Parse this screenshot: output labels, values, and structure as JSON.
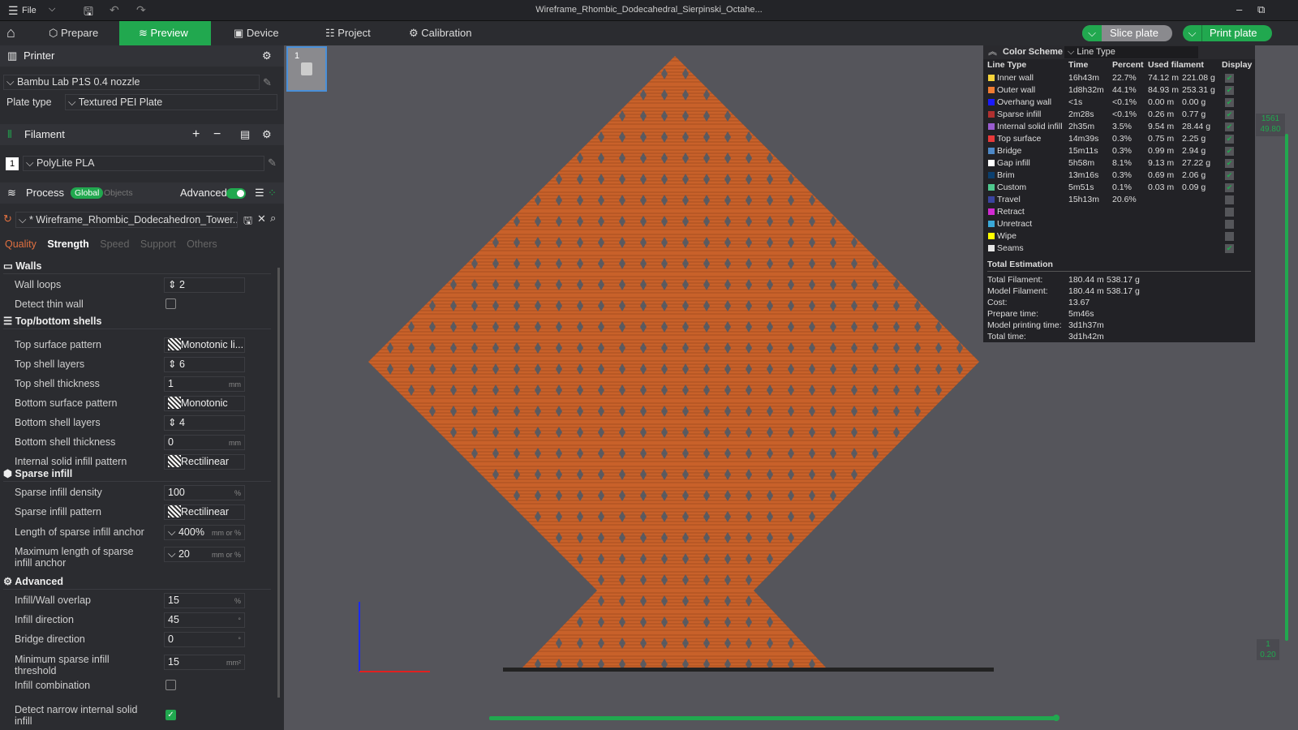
{
  "window": {
    "title": "Wireframe_Rhombic_Dodecahedral_Sierpinski_Octahe...",
    "file_menu": "File"
  },
  "tabs": [
    {
      "label": "Prepare"
    },
    {
      "label": "Preview"
    },
    {
      "label": "Device"
    },
    {
      "label": "Project"
    },
    {
      "label": "Calibration"
    }
  ],
  "actions": {
    "slice": "Slice plate",
    "print": "Print plate"
  },
  "printer": {
    "header": "Printer",
    "name": "Bambu Lab P1S 0.4 nozzle",
    "plate_label": "Plate type",
    "plate_value": "Textured PEI Plate"
  },
  "filament": {
    "header": "Filament",
    "index": "1",
    "name": "PolyLite PLA"
  },
  "process": {
    "header": "Process",
    "global": "Global",
    "objects": "Objects",
    "advanced": "Advanced",
    "advanced_on": true,
    "preset": "* Wireframe_Rhombic_Dodecahedron_Tower..."
  },
  "subtabs": [
    "Quality",
    "Strength",
    "Speed",
    "Support",
    "Others"
  ],
  "groups": {
    "walls": "Walls",
    "shells": "Top/bottom shells",
    "sparse": "Sparse infill",
    "advanced": "Advanced"
  },
  "settings": [
    {
      "label": "Wall loops",
      "value": "2",
      "type": "spin"
    },
    {
      "label": "Detect thin wall",
      "type": "check",
      "checked": false
    },
    {
      "label": "Top surface pattern",
      "value": "Monotonic li...",
      "type": "pattern"
    },
    {
      "label": "Top shell layers",
      "value": "6",
      "type": "spin"
    },
    {
      "label": "Top shell thickness",
      "value": "1",
      "unit": "mm"
    },
    {
      "label": "Bottom surface pattern",
      "value": "Monotonic",
      "type": "pattern"
    },
    {
      "label": "Bottom shell layers",
      "value": "4",
      "type": "spin"
    },
    {
      "label": "Bottom shell thickness",
      "value": "0",
      "unit": "mm"
    },
    {
      "label": "Internal solid infill pattern",
      "value": "Rectilinear",
      "type": "pattern"
    },
    {
      "label": "Sparse infill density",
      "value": "100",
      "unit": "%"
    },
    {
      "label": "Sparse infill pattern",
      "value": "Rectilinear",
      "type": "pattern"
    },
    {
      "label": "Length of sparse infill anchor",
      "value": "400%",
      "unit": "mm or %",
      "type": "combo"
    },
    {
      "label": "Maximum length of sparse infill anchor",
      "value": "20",
      "unit": "mm or %",
      "type": "combo"
    },
    {
      "label": "Infill/Wall overlap",
      "value": "15",
      "unit": "%"
    },
    {
      "label": "Infill direction",
      "value": "45",
      "unit": "°"
    },
    {
      "label": "Bridge direction",
      "value": "0",
      "unit": "°"
    },
    {
      "label": "Minimum sparse infill threshold",
      "value": "15",
      "unit": "mm²"
    },
    {
      "label": "Infill combination",
      "type": "check",
      "checked": false
    },
    {
      "label": "Detect narrow internal solid infill",
      "type": "check",
      "checked": true
    }
  ],
  "color_scheme": {
    "title": "Color Scheme",
    "mode": "Line Type",
    "headers": [
      "Line Type",
      "Time",
      "Percent",
      "Used filament",
      "Display"
    ],
    "rows": [
      {
        "name": "Inner wall",
        "color": "#f5d33b",
        "time": "16h43m",
        "pct": "22.7%",
        "len": "74.12 m",
        "wt": "221.08 g",
        "on": true
      },
      {
        "name": "Outer wall",
        "color": "#f07c32",
        "time": "1d8h32m",
        "pct": "44.1%",
        "len": "84.93 m",
        "wt": "253.31 g",
        "on": true
      },
      {
        "name": "Overhang wall",
        "color": "#1a1aff",
        "time": "<1s",
        "pct": "<0.1%",
        "len": "0.00 m",
        "wt": "0.00 g",
        "on": true
      },
      {
        "name": "Sparse infill",
        "color": "#b03030",
        "time": "2m28s",
        "pct": "<0.1%",
        "len": "0.26 m",
        "wt": "0.77 g",
        "on": true
      },
      {
        "name": "Internal solid infill",
        "color": "#9a5ccf",
        "time": "2h35m",
        "pct": "3.5%",
        "len": "9.54 m",
        "wt": "28.44 g",
        "on": true
      },
      {
        "name": "Top surface",
        "color": "#e83a3a",
        "time": "14m39s",
        "pct": "0.3%",
        "len": "0.75 m",
        "wt": "2.25 g",
        "on": true
      },
      {
        "name": "Bridge",
        "color": "#4d88c7",
        "time": "15m11s",
        "pct": "0.3%",
        "len": "0.99 m",
        "wt": "2.94 g",
        "on": true
      },
      {
        "name": "Gap infill",
        "color": "#ffffff",
        "time": "5h58m",
        "pct": "8.1%",
        "len": "9.13 m",
        "wt": "27.22 g",
        "on": true
      },
      {
        "name": "Brim",
        "color": "#0b3f6e",
        "time": "13m16s",
        "pct": "0.3%",
        "len": "0.69 m",
        "wt": "2.06 g",
        "on": true
      },
      {
        "name": "Custom",
        "color": "#4fc88e",
        "time": "5m51s",
        "pct": "0.1%",
        "len": "0.03 m",
        "wt": "0.09 g",
        "on": true
      },
      {
        "name": "Travel",
        "color": "#3a44a0",
        "time": "15h13m",
        "pct": "20.6%",
        "len": "",
        "wt": "",
        "on": false
      },
      {
        "name": "Retract",
        "color": "#d22ad2",
        "time": "",
        "pct": "",
        "len": "",
        "wt": "",
        "on": false
      },
      {
        "name": "Unretract",
        "color": "#3aa8d8",
        "time": "",
        "pct": "",
        "len": "",
        "wt": "",
        "on": false
      },
      {
        "name": "Wipe",
        "color": "#ffff00",
        "time": "",
        "pct": "",
        "len": "",
        "wt": "",
        "on": false
      },
      {
        "name": "Seams",
        "color": "#e6e6e6",
        "time": "",
        "pct": "",
        "len": "",
        "wt": "",
        "on": true
      }
    ],
    "total_title": "Total Estimation",
    "totals": [
      {
        "label": "Total Filament:",
        "a": "180.44 m",
        "b": "538.17 g"
      },
      {
        "label": "Model Filament:",
        "a": "180.44 m",
        "b": "538.17 g"
      },
      {
        "label": "Cost:",
        "a": "13.67",
        "b": ""
      },
      {
        "label": "Prepare time:",
        "a": "5m46s",
        "b": ""
      },
      {
        "label": "Model printing time:",
        "a": "3d1h37m",
        "b": ""
      },
      {
        "label": "Total time:",
        "a": "3d1h42m",
        "b": ""
      }
    ]
  },
  "layer_slider": {
    "top_layer": "1561",
    "top_height": "49.80",
    "bottom_layer": "1",
    "bottom_height": "0.20"
  },
  "plate": {
    "number": "1"
  },
  "colors": {
    "accent": "#21a84f",
    "model": "#c8612a"
  }
}
